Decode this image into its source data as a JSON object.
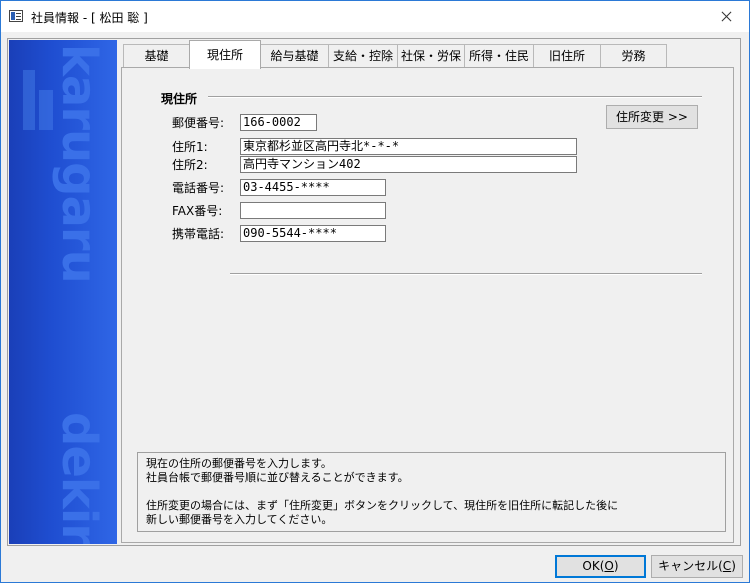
{
  "window": {
    "title": "社員情報 - [ 松田 聡 ]"
  },
  "brand": {
    "top_text": "karugaru",
    "bottom_text": "dekiru"
  },
  "tabs": [
    {
      "label": "基礎",
      "active": false
    },
    {
      "label": "現住所",
      "active": true
    },
    {
      "label": "給与基礎",
      "active": false
    },
    {
      "label": "支給・控除",
      "active": false
    },
    {
      "label": "社保・労保",
      "active": false
    },
    {
      "label": "所得・住民",
      "active": false
    },
    {
      "label": "旧住所",
      "active": false
    },
    {
      "label": "労務",
      "active": false
    }
  ],
  "section": {
    "title": "現住所"
  },
  "form": {
    "postal_label": "郵便番号:",
    "postal_value": "166-0002",
    "address1_label": "住所1:",
    "address1_value": "東京都杉並区高円寺北*-*-*",
    "address2_label": "住所2:",
    "address2_value": "高円寺マンション402",
    "phone_label": "電話番号:",
    "phone_value": "03-4455-****",
    "fax_label": "FAX番号:",
    "fax_value": "",
    "mobile_label": "携帯電話:",
    "mobile_value": "090-5544-****"
  },
  "address_change_button": "住所変更 >>",
  "help": {
    "line1": "現在の住所の郵便番号を入力します。",
    "line2": "社員台帳で郵便番号順に並び替えることができます。",
    "line3": "住所変更の場合には、まず「住所変更」ボタンをクリックして、現住所を旧住所に転記した後に",
    "line4": "新しい郵便番号を入力してください。"
  },
  "footer": {
    "ok_label": "OK(",
    "ok_key": "O",
    "cancel_label": "キャンセル(",
    "cancel_key": "C",
    "close_paren": ")"
  }
}
